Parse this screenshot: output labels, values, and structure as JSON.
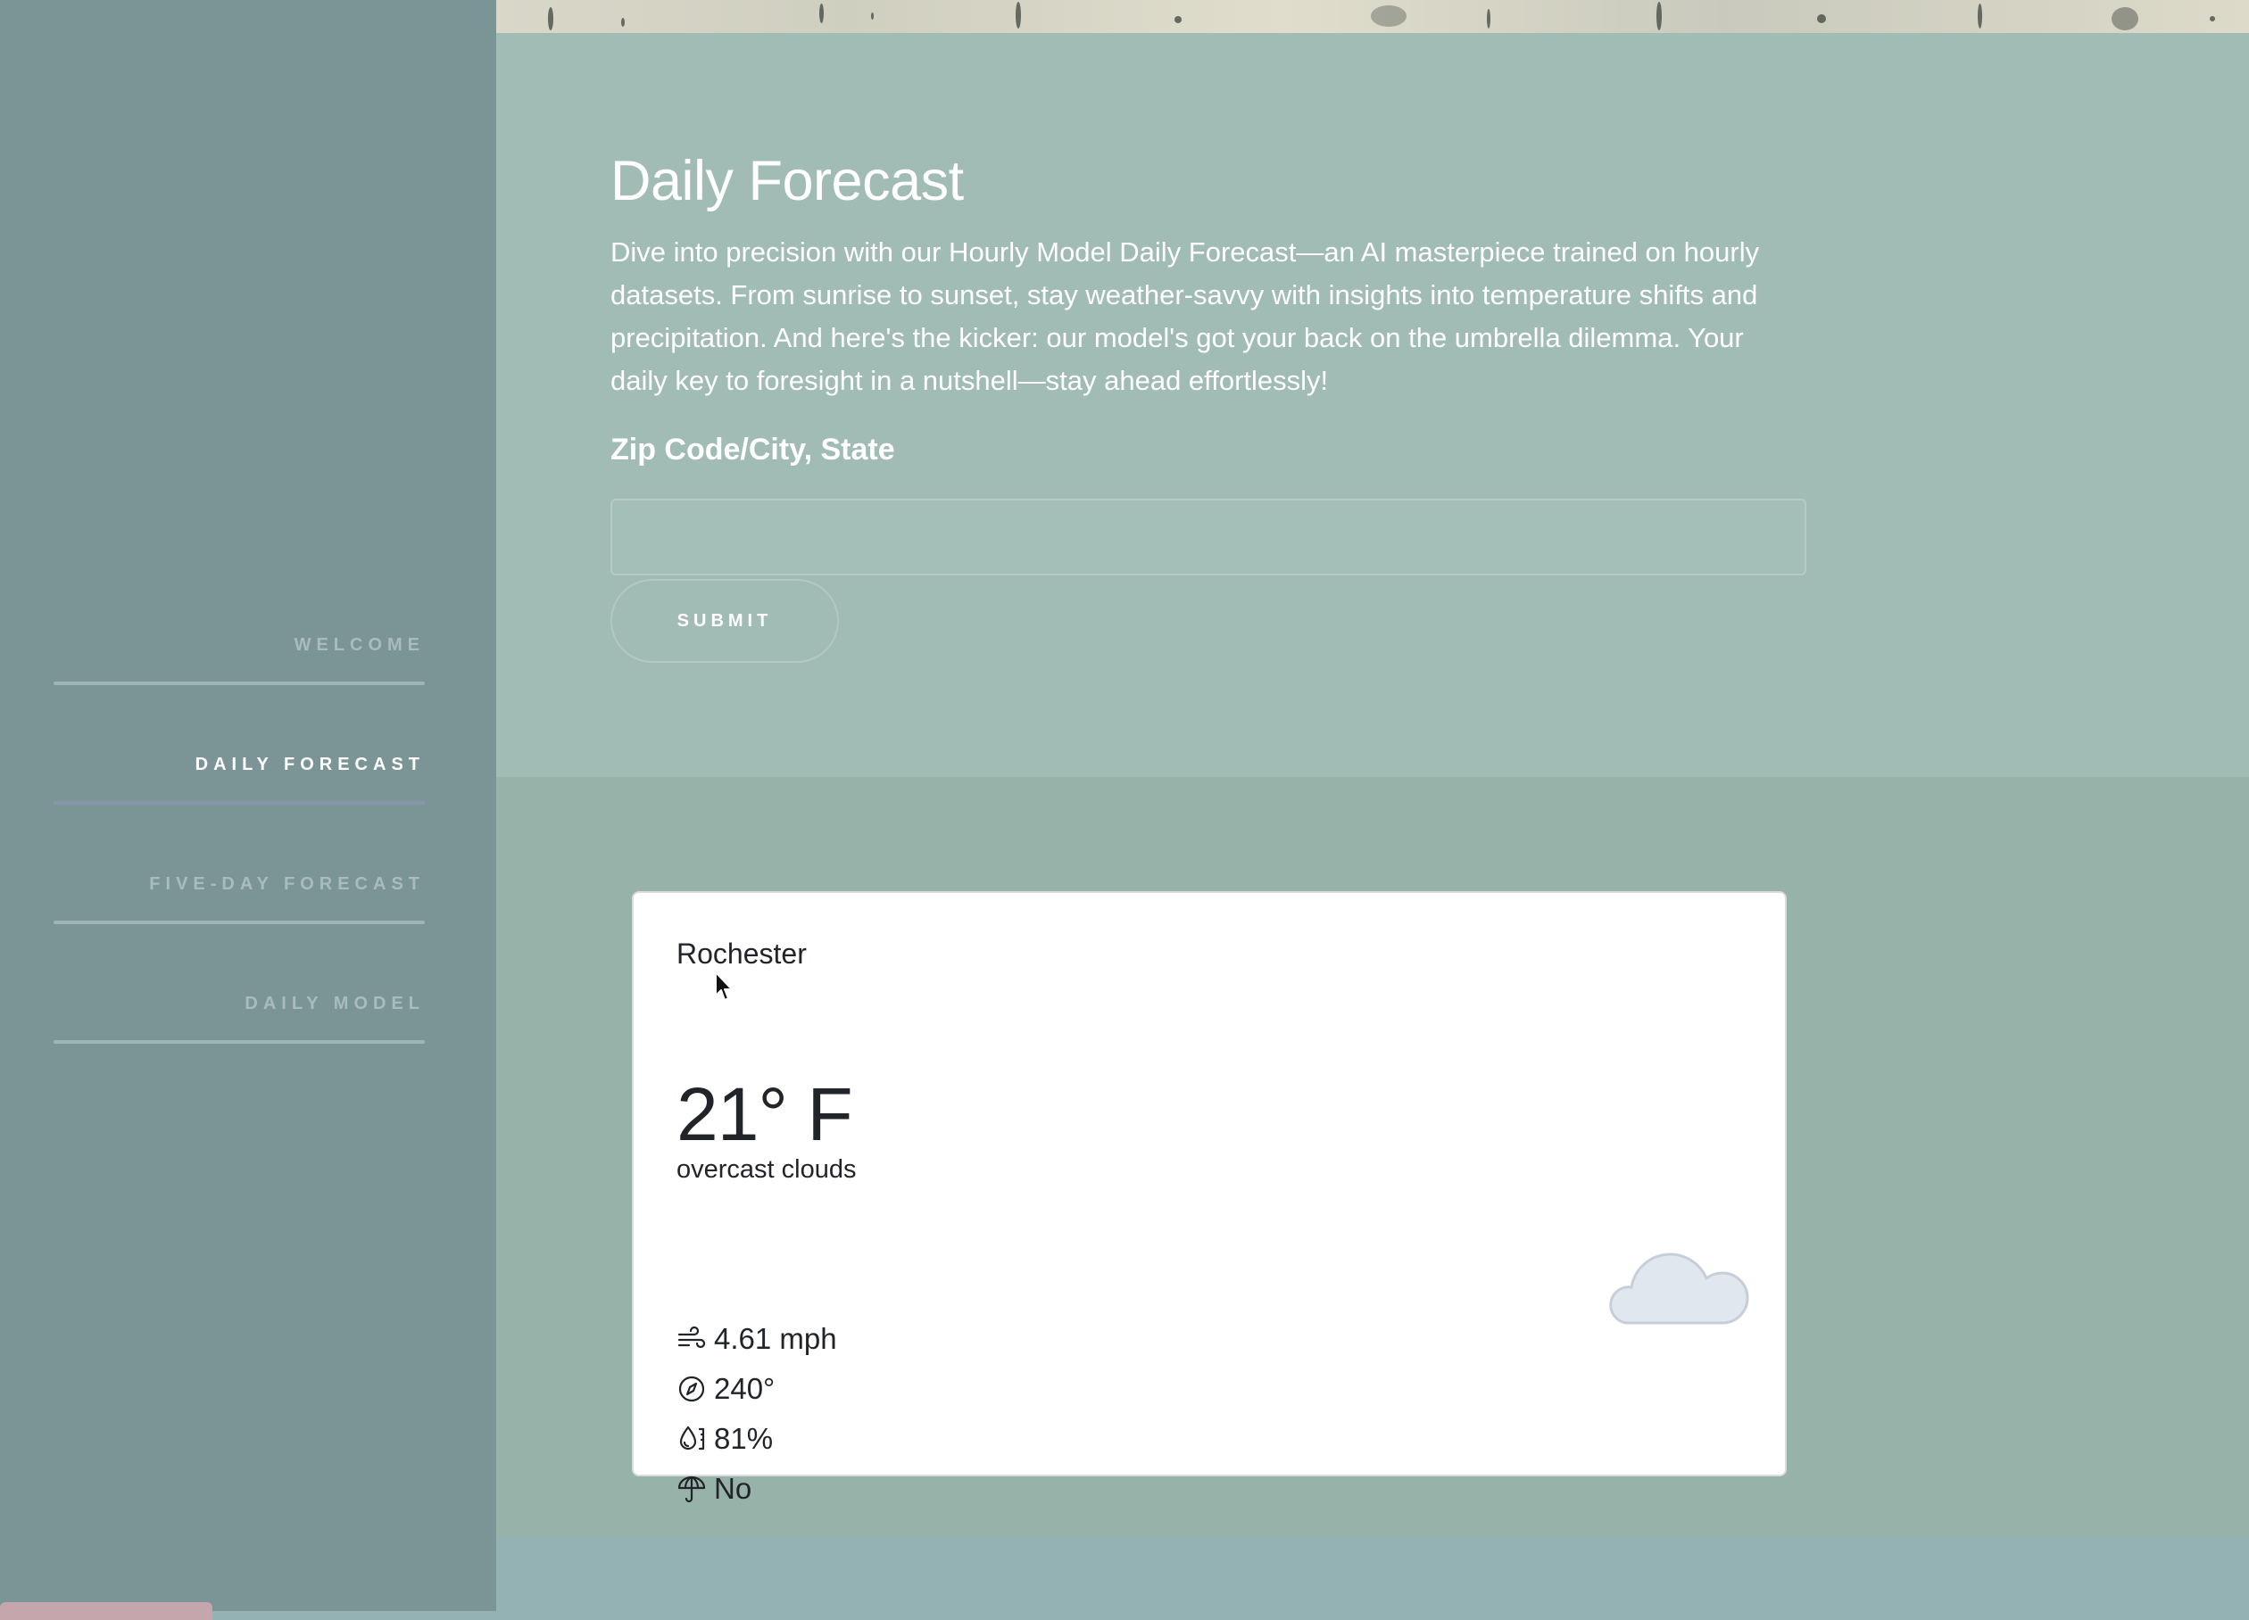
{
  "sidebar": {
    "items": [
      {
        "label": "WELCOME",
        "active": false
      },
      {
        "label": "DAILY FORECAST",
        "active": true
      },
      {
        "label": "FIVE-DAY FORECAST",
        "active": false
      },
      {
        "label": "DAILY MODEL",
        "active": false
      }
    ]
  },
  "header": {
    "title": "Daily Forecast",
    "description": "Dive into precision with our Hourly Model Daily Forecast—an AI masterpiece trained on hourly datasets. From sunrise to sunset, stay weather-savvy with insights into temperature shifts and precipitation. And here's the kicker: our model's got your back on the umbrella dilemma. Your daily key to foresight in a nutshell—stay ahead effortlessly!"
  },
  "form": {
    "label": "Zip Code/City, State",
    "input_value": "",
    "submit_label": "SUBMIT"
  },
  "weather": {
    "city": "Rochester",
    "temperature": "21° F",
    "description": "overcast clouds",
    "wind_speed": "4.61 mph",
    "wind_direction": "240°",
    "humidity": "81%",
    "umbrella": "No",
    "icon": "cloud-icon"
  },
  "colors": {
    "sidebar_bg": "#7b9596",
    "top_section_bg": "#a0bcb4",
    "result_section_bg": "#97b2a8",
    "bottom_bg": "#94b1b3",
    "active_nav_text": "#ffffff",
    "inactive_nav_text": "#a8bcbd"
  }
}
